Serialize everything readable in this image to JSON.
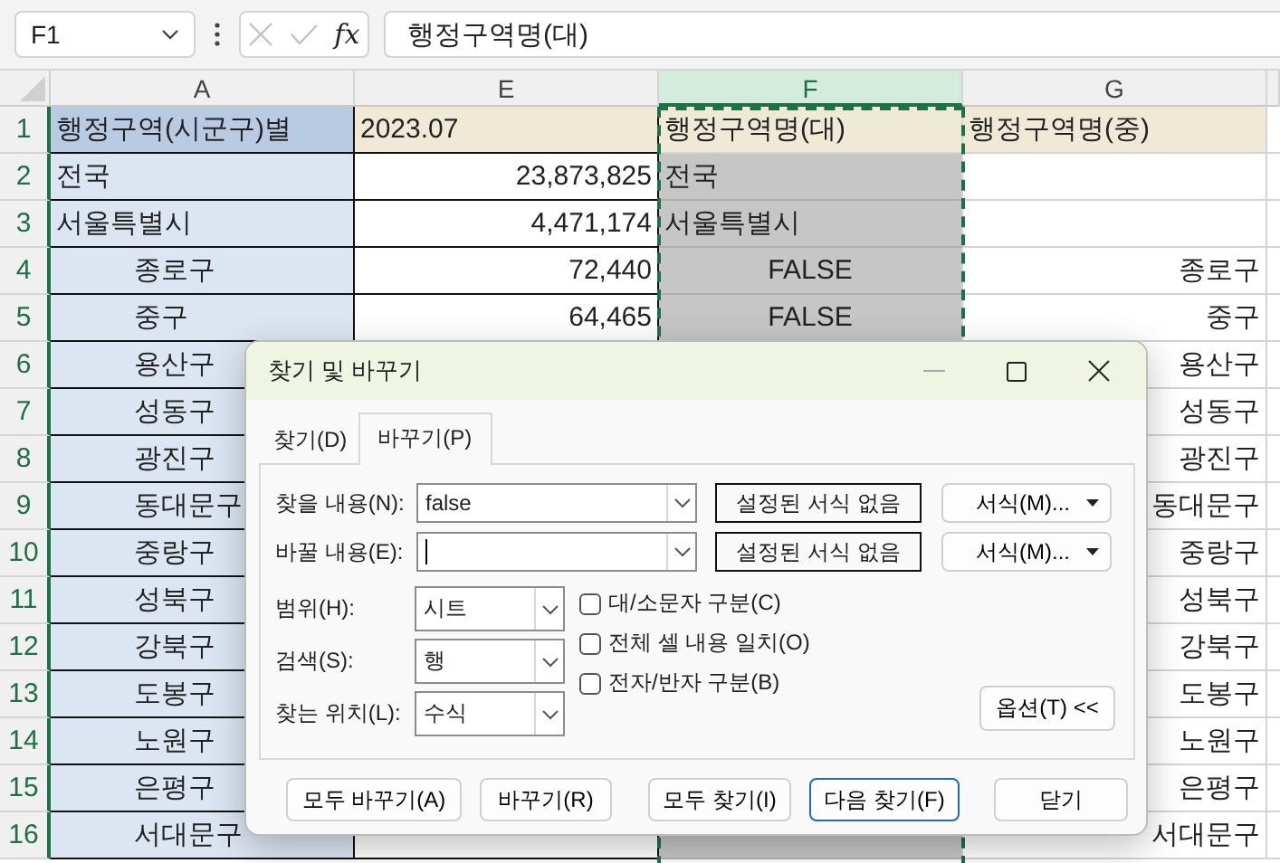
{
  "formula_bar": {
    "name_box": "F1",
    "function_label": "fx",
    "formula": "행정구역명(대)"
  },
  "columns": [
    {
      "label": "A",
      "selected": false
    },
    {
      "label": "E",
      "selected": false
    },
    {
      "label": "F",
      "selected": true
    },
    {
      "label": "G",
      "selected": false
    }
  ],
  "rows": [
    {
      "number": "1",
      "kind": "header",
      "cells": [
        "행정구역(시군구)별",
        "2023.07",
        "행정구역명(대)",
        "행정구역명(중)"
      ]
    },
    {
      "number": "2",
      "kind": "region",
      "cells": [
        "전국",
        "23,873,825",
        "전국",
        null
      ]
    },
    {
      "number": "3",
      "kind": "region",
      "cells": [
        "서울특별시",
        "4,471,174",
        "서울특별시",
        null
      ]
    },
    {
      "number": "4",
      "kind": "district",
      "cells": [
        "종로구",
        "72,440",
        "FALSE",
        "종로구"
      ]
    },
    {
      "number": "5",
      "kind": "district",
      "cells": [
        "중구",
        "64,465",
        "FALSE",
        "중구"
      ]
    },
    {
      "number": "6",
      "kind": "district",
      "cells": [
        "용산구",
        null,
        null,
        "용산구"
      ]
    },
    {
      "number": "7",
      "kind": "district",
      "cells": [
        "성동구",
        null,
        null,
        "성동구"
      ]
    },
    {
      "number": "8",
      "kind": "district",
      "cells": [
        "광진구",
        null,
        null,
        "광진구"
      ]
    },
    {
      "number": "9",
      "kind": "district",
      "cells": [
        "동대문구",
        null,
        null,
        "동대문구"
      ]
    },
    {
      "number": "10",
      "kind": "district",
      "cells": [
        "중랑구",
        null,
        null,
        "중랑구"
      ]
    },
    {
      "number": "11",
      "kind": "district",
      "cells": [
        "성북구",
        null,
        null,
        "성북구"
      ]
    },
    {
      "number": "12",
      "kind": "district",
      "cells": [
        "강북구",
        null,
        null,
        "강북구"
      ]
    },
    {
      "number": "13",
      "kind": "district",
      "cells": [
        "도봉구",
        null,
        null,
        "도봉구"
      ]
    },
    {
      "number": "14",
      "kind": "district",
      "cells": [
        "노원구",
        null,
        null,
        "노원구"
      ]
    },
    {
      "number": "15",
      "kind": "district",
      "cells": [
        "은평구",
        null,
        null,
        "은평구"
      ]
    },
    {
      "number": "16",
      "kind": "district",
      "cells": [
        "서대문구",
        null,
        null,
        "서대문구"
      ]
    }
  ],
  "dialog": {
    "title": "찾기 및 바꾸기",
    "tabs": [
      {
        "label": "찾기(D)",
        "selected": false
      },
      {
        "label": "바꾸기(P)",
        "selected": true
      }
    ],
    "fields": [
      {
        "label": "찾을 내용(N):",
        "value": "false",
        "focused": false,
        "format_preview": "설정된 서식 없음",
        "format_button": "서식(M)..."
      },
      {
        "label": "바꿀 내용(E):",
        "focused": true,
        "format_preview": "설정된 서식 없음",
        "format_button": "서식(M)..."
      }
    ],
    "options": [
      {
        "label": "범위(H):",
        "value": "시트"
      },
      {
        "label": "검색(S):",
        "value": "행"
      },
      {
        "label": "찾는 위치(L):",
        "value": "수식"
      }
    ],
    "checkboxes": [
      {
        "label": "대/소문자 구분(C)",
        "checked": false
      },
      {
        "label": "전체 셀 내용 일치(O)",
        "checked": false
      },
      {
        "label": "전자/반자 구분(B)",
        "checked": false
      }
    ],
    "options_button": "옵션(T) <<",
    "buttons": [
      {
        "label": "모두 바꾸기(A)",
        "default": false
      },
      {
        "label": "바꾸기(R)",
        "default": false
      },
      {
        "label": "모두 찾기(I)",
        "default": false
      },
      {
        "label": "다음 찾기(F)",
        "default": true
      },
      {
        "label": "닫기",
        "default": false
      }
    ]
  }
}
